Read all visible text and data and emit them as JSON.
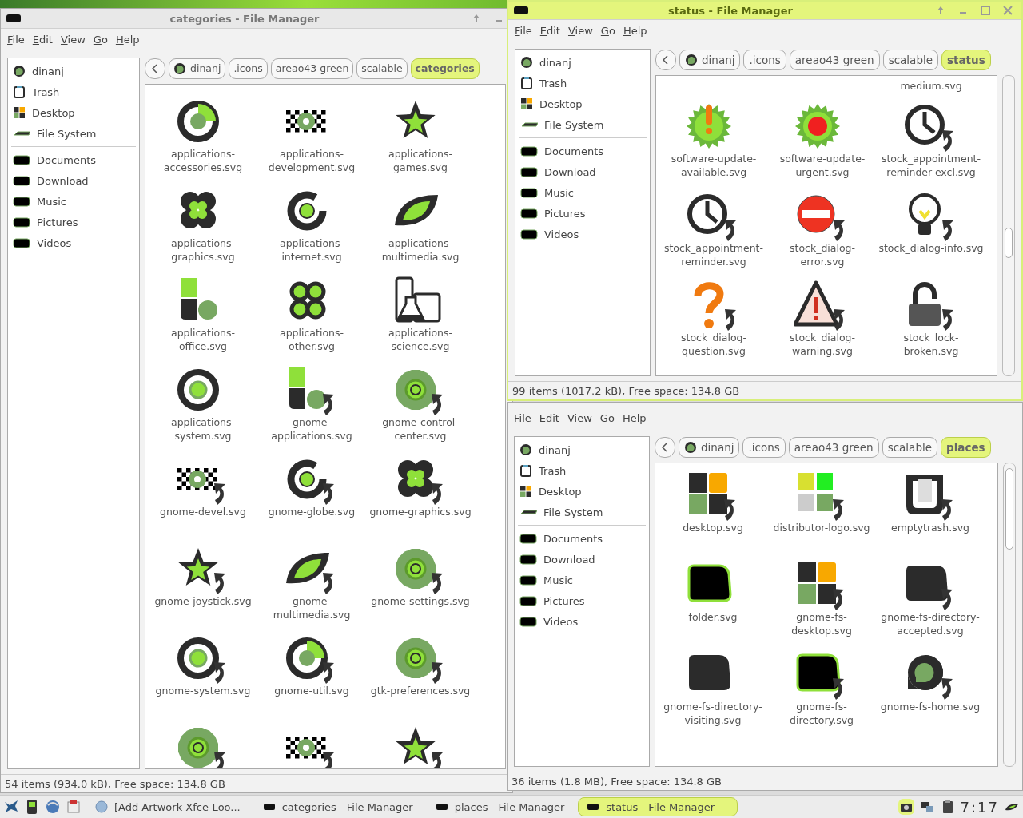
{
  "windows": [
    {
      "title": "categories - File Manager",
      "active": false,
      "menu": [
        "File",
        "Edit",
        "View",
        "Go",
        "Help"
      ],
      "places": [
        {
          "label": "dinanj",
          "kind": "home"
        },
        {
          "label": "Trash",
          "kind": "trash"
        },
        {
          "label": "Desktop",
          "kind": "desktop"
        },
        {
          "label": "File System",
          "kind": "drive"
        }
      ],
      "bookmarks": [
        {
          "label": "Documents",
          "kind": "folder"
        },
        {
          "label": "Download",
          "kind": "folder"
        },
        {
          "label": "Music",
          "kind": "folder"
        },
        {
          "label": "Pictures",
          "kind": "folder"
        },
        {
          "label": "Videos",
          "kind": "folder"
        }
      ],
      "path": [
        {
          "label": "dinanj",
          "kind": "home",
          "selected": false
        },
        {
          "label": ".icons",
          "kind": "folder",
          "selected": false
        },
        {
          "label": "areao43 green",
          "kind": "folder",
          "selected": false
        },
        {
          "label": "scalable",
          "kind": "folder",
          "selected": false
        },
        {
          "label": "categories",
          "kind": "folder",
          "selected": true
        }
      ],
      "files": [
        {
          "name": "applications-accessories.svg",
          "kind": "split-circle",
          "link": false
        },
        {
          "name": "applications-development.svg",
          "kind": "checker",
          "link": false
        },
        {
          "name": "applications-games.svg",
          "kind": "star",
          "link": false
        },
        {
          "name": "applications-graphics.svg",
          "kind": "clover",
          "link": false
        },
        {
          "name": "applications-internet.svg",
          "kind": "swirl",
          "link": false
        },
        {
          "name": "applications-multimedia.svg",
          "kind": "leaf",
          "link": false
        },
        {
          "name": "applications-office.svg",
          "kind": "blocks",
          "link": false
        },
        {
          "name": "applications-other.svg",
          "kind": "rings",
          "link": false
        },
        {
          "name": "applications-science.svg",
          "kind": "flask",
          "link": false
        },
        {
          "name": "applications-system.svg",
          "kind": "target",
          "link": false
        },
        {
          "name": "gnome-applications.svg",
          "kind": "blocks",
          "link": true
        },
        {
          "name": "gnome-control-center.svg",
          "kind": "gear",
          "link": true
        },
        {
          "name": "gnome-devel.svg",
          "kind": "checker",
          "link": true
        },
        {
          "name": "gnome-globe.svg",
          "kind": "swirl",
          "link": true
        },
        {
          "name": "gnome-graphics.svg",
          "kind": "clover",
          "link": true
        },
        {
          "name": "gnome-joystick.svg",
          "kind": "star",
          "link": true
        },
        {
          "name": "gnome-multimedia.svg",
          "kind": "leaf",
          "link": true
        },
        {
          "name": "gnome-settings.svg",
          "kind": "gear",
          "link": true
        },
        {
          "name": "gnome-system.svg",
          "kind": "target",
          "link": true
        },
        {
          "name": "gnome-util.svg",
          "kind": "split-circle",
          "link": true
        },
        {
          "name": "gtk-preferences.svg",
          "kind": "gear",
          "link": true
        },
        {
          "kind": "gear",
          "link": true
        },
        {
          "kind": "checker",
          "link": true
        },
        {
          "kind": "star",
          "link": true
        }
      ],
      "status": "54 items (934.0 kB), Free space: 134.8 GB"
    },
    {
      "title": "status - File Manager",
      "active": true,
      "menu": [
        "File",
        "Edit",
        "View",
        "Go",
        "Help"
      ],
      "places": [
        {
          "label": "dinanj",
          "kind": "home"
        },
        {
          "label": "Trash",
          "kind": "trash"
        },
        {
          "label": "Desktop",
          "kind": "desktop"
        },
        {
          "label": "File System",
          "kind": "drive"
        }
      ],
      "bookmarks": [
        {
          "label": "Documents",
          "kind": "folder"
        },
        {
          "label": "Download",
          "kind": "folder"
        },
        {
          "label": "Music",
          "kind": "folder"
        },
        {
          "label": "Pictures",
          "kind": "folder"
        },
        {
          "label": "Videos",
          "kind": "folder"
        }
      ],
      "path": [
        {
          "label": "dinanj",
          "kind": "home",
          "selected": false
        },
        {
          "label": ".icons",
          "kind": "folder",
          "selected": false
        },
        {
          "label": "areao43 green",
          "kind": "folder",
          "selected": false
        },
        {
          "label": "scalable",
          "kind": "folder",
          "selected": false
        },
        {
          "label": "status",
          "kind": "folder",
          "selected": true
        }
      ],
      "files": [
        {
          "name": "medium.svg",
          "kind": "cut"
        },
        {
          "name": "software-update-available.svg",
          "kind": "burst-alert",
          "link": false
        },
        {
          "name": "software-update-urgent.svg",
          "kind": "burst-red",
          "link": false
        },
        {
          "name": "stock_appointment-reminder-excl.svg",
          "kind": "clock",
          "link": true
        },
        {
          "name": "stock_appointment-reminder.svg",
          "kind": "clock",
          "link": true
        },
        {
          "name": "stock_dialog-error.svg",
          "kind": "stop",
          "link": true
        },
        {
          "name": "stock_dialog-info.svg",
          "kind": "bulb",
          "link": true
        },
        {
          "name": "stock_dialog-question.svg",
          "kind": "question",
          "link": true
        },
        {
          "name": "stock_dialog-warning.svg",
          "kind": "warning",
          "link": true
        },
        {
          "name": "stock_lock-broken.svg",
          "kind": "lock",
          "link": true
        }
      ],
      "status": "99 items (1017.2 kB), Free space: 134.8 GB"
    },
    {
      "active": false,
      "menu": [
        "File",
        "Edit",
        "View",
        "Go",
        "Help"
      ],
      "places": [
        {
          "label": "dinanj",
          "kind": "home"
        },
        {
          "label": "Trash",
          "kind": "trash"
        },
        {
          "label": "Desktop",
          "kind": "desktop"
        },
        {
          "label": "File System",
          "kind": "drive"
        }
      ],
      "bookmarks": [
        {
          "label": "Documents",
          "kind": "folder"
        },
        {
          "label": "Download",
          "kind": "folder"
        },
        {
          "label": "Music",
          "kind": "folder"
        },
        {
          "label": "Pictures",
          "kind": "folder"
        },
        {
          "label": "Videos",
          "kind": "folder"
        }
      ],
      "path": [
        {
          "label": "dinanj",
          "kind": "home",
          "selected": false
        },
        {
          "label": ".icons",
          "kind": "folder",
          "selected": false
        },
        {
          "label": "areao43 green",
          "kind": "folder",
          "selected": false
        },
        {
          "label": "scalable",
          "kind": "folder",
          "selected": false
        },
        {
          "label": "places",
          "kind": "folder",
          "selected": true
        }
      ],
      "files": [
        {
          "name": "desktop.svg",
          "kind": "quad",
          "link": true
        },
        {
          "name": "distributor-logo.svg",
          "kind": "quad-bright",
          "link": true
        },
        {
          "name": "emptytrash.svg",
          "kind": "trash",
          "link": true
        },
        {
          "name": "folder.svg",
          "kind": "folder",
          "link": false
        },
        {
          "name": "gnome-fs-desktop.svg",
          "kind": "quad",
          "link": true
        },
        {
          "name": "gnome-fs-directory-accepted.svg",
          "kind": "folder-dark",
          "link": true
        },
        {
          "name": "gnome-fs-directory-visiting.svg",
          "kind": "folder-dark",
          "link": false
        },
        {
          "name": "gnome-fs-directory.svg",
          "kind": "folder",
          "link": true
        },
        {
          "name": "gnome-fs-home.svg",
          "kind": "home",
          "link": true
        }
      ],
      "status": "36 items (1.8 MB), Free space: 134.8 GB"
    }
  ],
  "taskbar": {
    "tasks": [
      {
        "label": "[Add Artwork Xfce-Loo...",
        "kind": "browser",
        "selected": false
      },
      {
        "label": "categories - File Manager",
        "kind": "window",
        "selected": false
      },
      {
        "label": "places - File Manager",
        "kind": "window",
        "selected": false
      },
      {
        "label": "status - File Manager",
        "kind": "window",
        "selected": true
      }
    ],
    "clock": "7:17"
  }
}
